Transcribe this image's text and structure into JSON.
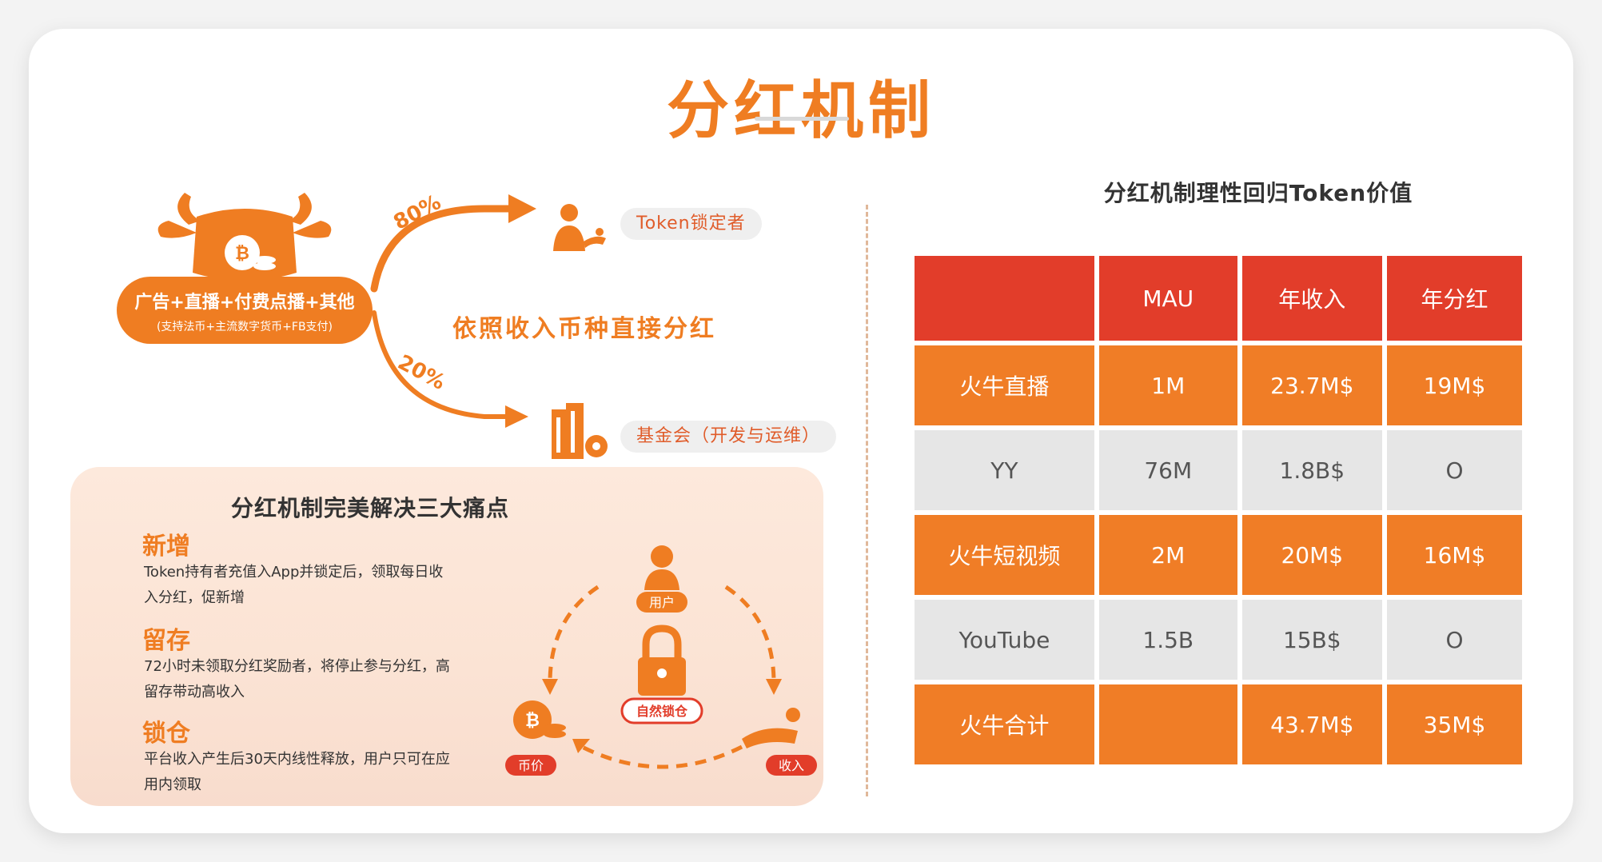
{
  "title": "分红机制",
  "flow": {
    "source_main": "广告+直播+付费点播+其他",
    "source_sub": "(支持法币+主流数字货币+FB支付)",
    "pct_top": "80%",
    "pct_bottom": "20%",
    "center_text": "依照收入币种直接分红",
    "target_top": "Token锁定者",
    "target_bottom": "基金会（开发与运维）"
  },
  "pain_points": {
    "title": "分红机制完美解决三大痛点",
    "items": [
      {
        "head": "新增",
        "body": "Token持有者充值入App并锁定后，领取每日收入分红，促新增"
      },
      {
        "head": "留存",
        "body": "72小时未领取分红奖励者，将停止参与分红，高留存带动高收入"
      },
      {
        "head": "锁仓",
        "body": "平台收入产生后30天内线性释放，用户只可在应用内领取"
      }
    ],
    "cycle": {
      "user": "用户",
      "center": "自然锁仓",
      "coin": "币价",
      "income": "收入"
    }
  },
  "table": {
    "title": "分红机制理性回归Token价值",
    "headers": [
      "",
      "MAU",
      "年收入",
      "年分红"
    ],
    "rows": [
      {
        "cells": [
          "火牛直播",
          "1M",
          "23.7M$",
          "19M$"
        ],
        "highlight": true
      },
      {
        "cells": [
          "YY",
          "76M",
          "1.8B$",
          "O"
        ],
        "highlight": false
      },
      {
        "cells": [
          "火牛短视频",
          "2M",
          "20M$",
          "16M$"
        ],
        "highlight": true
      },
      {
        "cells": [
          "YouTube",
          "1.5B",
          "15B$",
          "O"
        ],
        "highlight": false
      },
      {
        "cells": [
          "火牛合计",
          "",
          "43.7M$",
          "35M$"
        ],
        "highlight": true
      }
    ]
  },
  "colors": {
    "accent": "#ef7d22",
    "header_red": "#e23d2a",
    "row_gray": "#e6e6e6"
  }
}
